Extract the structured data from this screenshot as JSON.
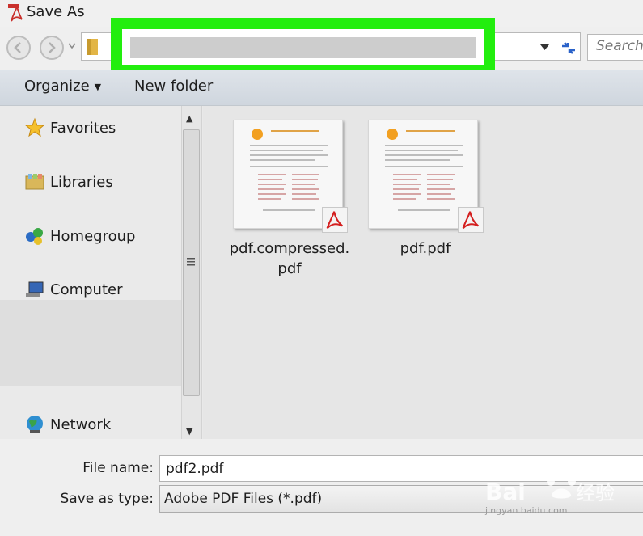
{
  "window": {
    "title": "Save As"
  },
  "address": {
    "path": ""
  },
  "search": {
    "placeholder": "Search"
  },
  "toolbar": {
    "organize_label": "Organize",
    "new_folder_label": "New folder"
  },
  "nav": {
    "items": [
      {
        "label": "Favorites",
        "icon": "star-icon"
      },
      {
        "label": "Libraries",
        "icon": "libraries-icon"
      },
      {
        "label": "Homegroup",
        "icon": "homegroup-icon"
      },
      {
        "label": "Computer",
        "icon": "computer-icon"
      },
      {
        "label": "Network",
        "icon": "network-icon"
      }
    ]
  },
  "files": [
    {
      "name_line1": "pdf.compressed.",
      "name_line2": "pdf",
      "icon": "pdf-icon"
    },
    {
      "name_line1": "pdf.pdf",
      "name_line2": "",
      "icon": "pdf-icon"
    }
  ],
  "fields": {
    "file_name_label": "File name:",
    "file_name_value": "pdf2.pdf",
    "save_type_label": "Save as type:",
    "save_type_value": "Adobe PDF Files (*.pdf)"
  },
  "watermark": {
    "text": "jingyan.baidu.com"
  },
  "colors": {
    "highlight": "#22ee0e",
    "pdf_red": "#d42020",
    "thumb_accent": "#f2a021"
  }
}
